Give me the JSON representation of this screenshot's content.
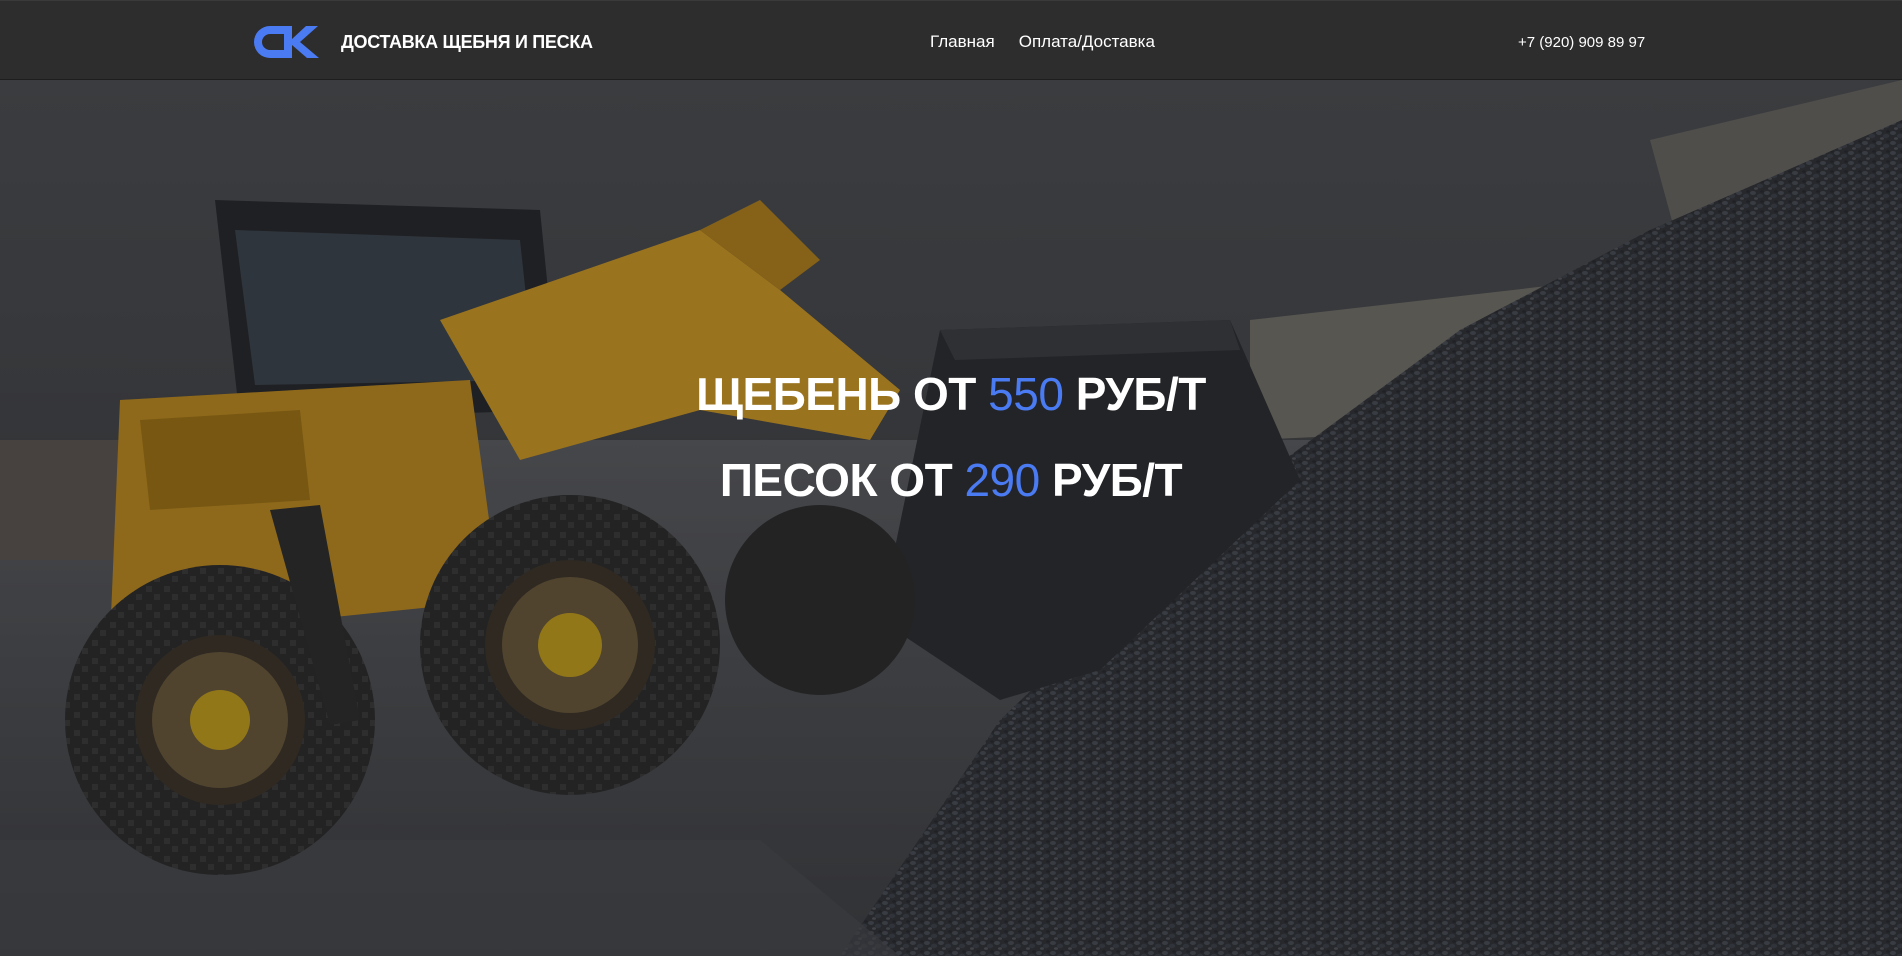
{
  "header": {
    "logo_icon": "ck-logo-icon",
    "brand": "ДОСТАВКА ЩЕБНЯ И ПЕСКА",
    "nav": [
      {
        "label": "Главная"
      },
      {
        "label": "Оплата/Доставка"
      }
    ],
    "phone": "+7 (920) 909 89 97"
  },
  "hero": {
    "background": "loader-and-gravel-photo",
    "line1": {
      "prefix": "ЩЕБЕНЬ ОТ",
      "price": "550",
      "suffix": "РУБ/Т"
    },
    "line2": {
      "prefix": "ПЕСОК ОТ",
      "price": "290",
      "suffix": "РУБ/Т"
    }
  },
  "colors": {
    "accent": "#4a7bf2",
    "header_bg": "#2d2d2d",
    "text": "#ffffff"
  }
}
